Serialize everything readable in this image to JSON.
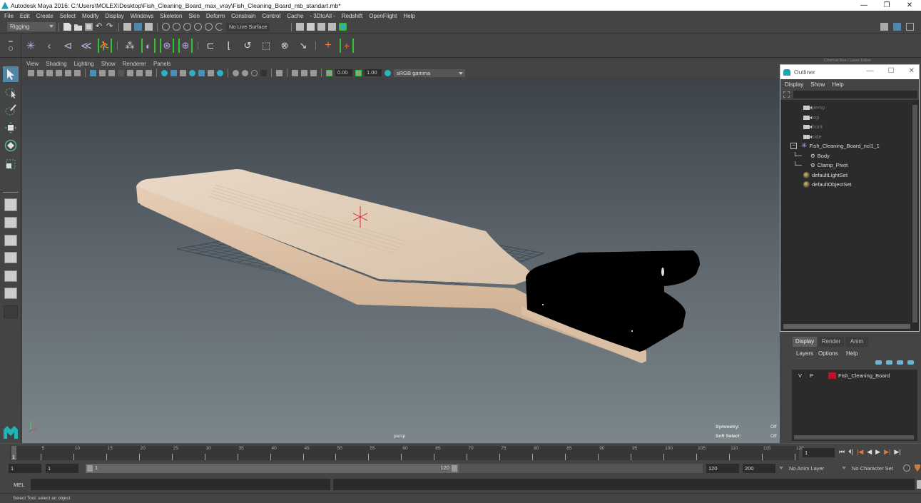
{
  "window": {
    "title": "Autodesk Maya 2016: C:\\Users\\MOLEX\\Desktop\\Fish_Cleaning_Board_max_vray\\Fish_Cleaning_Board_mb_standart.mb*",
    "minimize": "—",
    "maximize": "❐",
    "close": "✕"
  },
  "menubar": [
    "File",
    "Edit",
    "Create",
    "Select",
    "Modify",
    "Display",
    "Windows",
    "Skeleton",
    "Skin",
    "Deform",
    "Constrain",
    "Control",
    "Cache",
    "- 3DtoAll -",
    "Redshift",
    "OpenFlight",
    "Help"
  ],
  "statusline": {
    "menuset": "Rigging",
    "live_surface": "No Live Surface"
  },
  "viewport": {
    "menus": [
      "View",
      "Shading",
      "Lighting",
      "Show",
      "Renderer",
      "Panels"
    ],
    "exposure": "0.00",
    "gamma": "1.00",
    "color_space": "sRGB gamma",
    "camera_label": "persp",
    "hud": {
      "symmetry_label": "Symmetry:",
      "symmetry_value": "Off",
      "soft_select_label": "Soft Select:",
      "soft_select_value": "Off"
    }
  },
  "channel_box": {
    "title": "Channel Box / Layer Editor"
  },
  "outliner": {
    "title": "Outliner",
    "menus": [
      "Display",
      "Show",
      "Help"
    ],
    "items": [
      {
        "label": "persp",
        "type": "camera",
        "dim": true
      },
      {
        "label": "top",
        "type": "camera",
        "dim": true
      },
      {
        "label": "front",
        "type": "camera",
        "dim": true
      },
      {
        "label": "side",
        "type": "camera",
        "dim": true
      },
      {
        "label": "Fish_Cleaning_Board_ncl1_1",
        "type": "group",
        "expanded": true
      },
      {
        "label": "Body",
        "type": "mesh",
        "child": true
      },
      {
        "label": "Clamp_Pivot",
        "type": "mesh",
        "child": true
      },
      {
        "label": "defaultLightSet",
        "type": "set"
      },
      {
        "label": "defaultObjectSet",
        "type": "set"
      }
    ]
  },
  "layer_editor": {
    "tabs": [
      "Display",
      "Render",
      "Anim"
    ],
    "active_tab": "Display",
    "menus": [
      "Layers",
      "Options",
      "Help"
    ],
    "layers": [
      {
        "visible": "V",
        "playback": "P",
        "color": "#c0102a",
        "name": "Fish_Cleaning_Board"
      }
    ]
  },
  "timeline": {
    "ticks": [
      5,
      10,
      15,
      20,
      25,
      30,
      35,
      40,
      45,
      50,
      55,
      60,
      65,
      70,
      75,
      80,
      85,
      90,
      95,
      100,
      105,
      110,
      115,
      120
    ],
    "start": 1,
    "end": 120,
    "current_frame_marker": "1",
    "current_frame": "1"
  },
  "range": {
    "start_time": "1",
    "playback_start": "1",
    "range_start_label": "1",
    "range_end_label": "120",
    "playback_end": "120",
    "end_time": "200",
    "anim_layer": "No Anim Layer",
    "character_set": "No Character Set"
  },
  "command_line": {
    "label": "MEL"
  },
  "help_line": "Select Tool: select an object"
}
